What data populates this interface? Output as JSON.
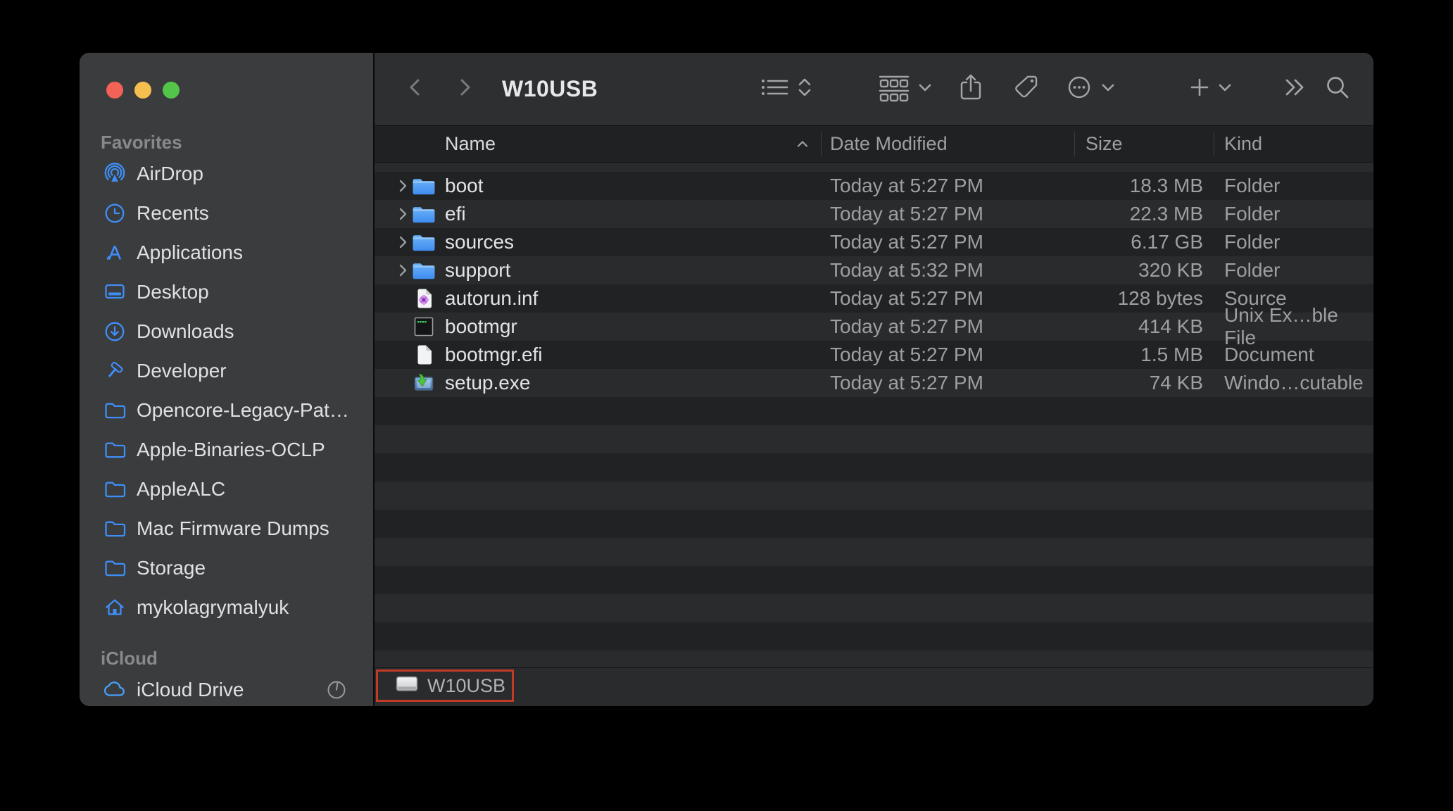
{
  "window": {
    "title": "W10USB"
  },
  "sidebar": {
    "sections": [
      {
        "label": "Favorites",
        "items": [
          {
            "label": "AirDrop",
            "icon": "airdrop-icon"
          },
          {
            "label": "Recents",
            "icon": "clock-icon"
          },
          {
            "label": "Applications",
            "icon": "app-store-icon"
          },
          {
            "label": "Desktop",
            "icon": "desktop-icon"
          },
          {
            "label": "Downloads",
            "icon": "download-circle-icon"
          },
          {
            "label": "Developer",
            "icon": "hammer-icon"
          },
          {
            "label": "Opencore-Legacy-Pat…",
            "icon": "folder-icon"
          },
          {
            "label": "Apple-Binaries-OCLP",
            "icon": "folder-icon"
          },
          {
            "label": "AppleALC",
            "icon": "folder-icon"
          },
          {
            "label": "Mac Firmware Dumps",
            "icon": "folder-icon"
          },
          {
            "label": "Storage",
            "icon": "folder-icon"
          },
          {
            "label": "mykolagrymalyuk",
            "icon": "home-icon"
          }
        ]
      },
      {
        "label": "iCloud",
        "items": [
          {
            "label": "iCloud Drive",
            "icon": "cloud-icon",
            "trailing_icon": "sync-progress-icon"
          }
        ]
      }
    ]
  },
  "list": {
    "columns": {
      "name": "Name",
      "date": "Date Modified",
      "size": "Size",
      "kind": "Kind",
      "sort": "ascending"
    },
    "rows": [
      {
        "name": "boot",
        "icon": "folder",
        "date": "Today at 5:27 PM",
        "size": "18.3 MB",
        "kind": "Folder"
      },
      {
        "name": "efi",
        "icon": "folder",
        "date": "Today at 5:27 PM",
        "size": "22.3 MB",
        "kind": "Folder"
      },
      {
        "name": "sources",
        "icon": "folder",
        "date": "Today at 5:27 PM",
        "size": "6.17 GB",
        "kind": "Folder"
      },
      {
        "name": "support",
        "icon": "folder",
        "date": "Today at 5:32 PM",
        "size": "320 KB",
        "kind": "Folder"
      },
      {
        "name": "autorun.inf",
        "icon": "source-file",
        "date": "Today at 5:27 PM",
        "size": "128 bytes",
        "kind": "Source"
      },
      {
        "name": "bootmgr",
        "icon": "unix-executable",
        "date": "Today at 5:27 PM",
        "size": "414 KB",
        "kind": "Unix Ex…ble File"
      },
      {
        "name": "bootmgr.efi",
        "icon": "document",
        "date": "Today at 5:27 PM",
        "size": "1.5 MB",
        "kind": "Document"
      },
      {
        "name": "setup.exe",
        "icon": "windows-executable",
        "date": "Today at 5:27 PM",
        "size": "74 KB",
        "kind": "Windo…cutable"
      }
    ]
  },
  "pathbar": {
    "volume": "W10USB",
    "icon": "disk-icon",
    "annotated": true
  },
  "colors": {
    "sidebar_accent": "#3f8ef7",
    "annotation_red": "#c23b27",
    "traffic_red": "#f26257",
    "traffic_yellow": "#f5bf4f",
    "traffic_green": "#53c64a",
    "row_dark": "#202224",
    "row_light": "#292b2d",
    "sidebar_bg": "#3a3c3e",
    "toolbar_bg": "#2d2f31"
  }
}
